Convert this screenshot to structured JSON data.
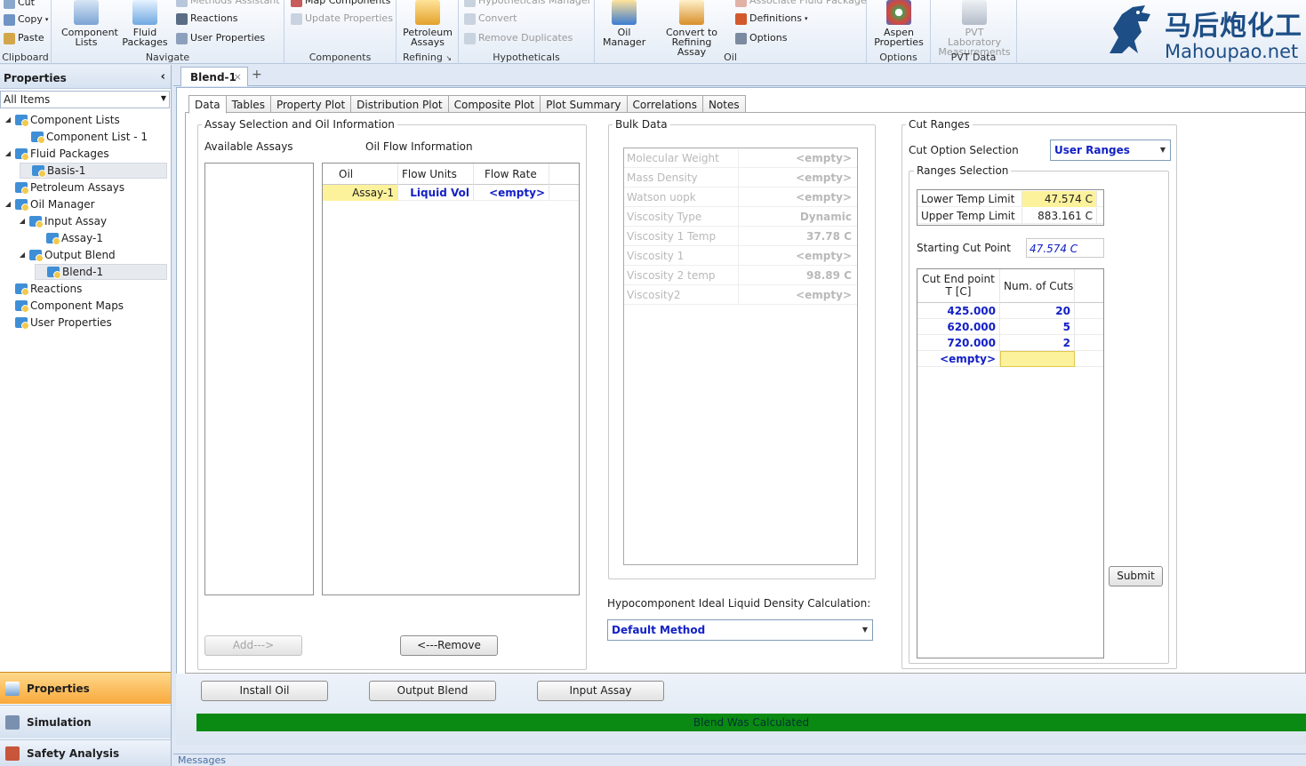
{
  "ribbon": {
    "clipboard": {
      "label": "Clipboard",
      "cut": "Cut",
      "copy": "Copy",
      "paste": "Paste"
    },
    "navigate": {
      "label": "Navigate",
      "component_lists": "Component Lists",
      "fluid_packages": "Fluid Packages",
      "methods_assistant": "Methods Assistant",
      "reactions": "Reactions",
      "user_properties": "User Properties"
    },
    "components": {
      "label": "Components",
      "map_components": "Map Components",
      "update_properties": "Update Properties"
    },
    "refining": {
      "label": "Refining",
      "petroleum_assays": "Petroleum Assays"
    },
    "hypotheticals": {
      "label": "Hypotheticals",
      "manager": "Hypotheticals Manager",
      "convert": "Convert",
      "remove_duplicates": "Remove Duplicates"
    },
    "oil": {
      "label": "Oil",
      "oil_manager": "Oil Manager",
      "convert_to_refining_assay": "Convert to Refining Assay",
      "associate_fluid_package": "Associate Fluid Package",
      "definitions": "Definitions",
      "options": "Options"
    },
    "options": {
      "label": "Options",
      "aspen_properties": "Aspen Properties"
    },
    "pvt": {
      "label": "PVT Data",
      "pvt_lab": "PVT Laboratory Measurements"
    }
  },
  "logo": {
    "cn": "马后炮化工",
    "en": "Mahoupao.net"
  },
  "left_panel": {
    "title": "Properties",
    "filter": "All Items",
    "tree": [
      {
        "label": "Component Lists"
      },
      {
        "label": "Component List - 1"
      },
      {
        "label": "Fluid Packages"
      },
      {
        "label": "Basis-1"
      },
      {
        "label": "Petroleum Assays"
      },
      {
        "label": "Oil Manager"
      },
      {
        "label": "Input Assay"
      },
      {
        "label": "Assay-1"
      },
      {
        "label": "Output Blend"
      },
      {
        "label": "Blend-1"
      },
      {
        "label": "Reactions"
      },
      {
        "label": "Component Maps"
      },
      {
        "label": "User Properties"
      }
    ],
    "nav": {
      "properties": "Properties",
      "simulation": "Simulation",
      "safety": "Safety Analysis"
    }
  },
  "doc_tab": {
    "title": "Blend-1",
    "close": "×",
    "add": "+"
  },
  "tabs": [
    "Data",
    "Tables",
    "Property Plot",
    "Distribution Plot",
    "Composite Plot",
    "Plot Summary",
    "Correlations",
    "Notes"
  ],
  "assay_section": {
    "legend": "Assay Selection and Oil Information",
    "available_label": "Available Assays",
    "oil_flow_label": "Oil Flow Information",
    "columns": [
      "Oil",
      "Flow Units",
      "Flow Rate"
    ],
    "row": {
      "oil": "Assay-1",
      "units": "Liquid Vol",
      "rate": "<empty>"
    },
    "add_button": "Add--->",
    "remove_button": "<---Remove"
  },
  "bulk": {
    "legend": "Bulk Data",
    "rows": [
      {
        "name": "Molecular Weight",
        "value": "<empty>"
      },
      {
        "name": "Mass Density",
        "value": "<empty>"
      },
      {
        "name": "Watson uopk",
        "value": "<empty>"
      },
      {
        "name": "Viscosity Type",
        "value": "Dynamic"
      },
      {
        "name": "Viscosity 1 Temp",
        "value": "37.78 C"
      },
      {
        "name": "Viscosity 1",
        "value": "<empty>"
      },
      {
        "name": "Viscosity 2 temp",
        "value": "98.89 C"
      },
      {
        "name": "Viscosity2",
        "value": "<empty>"
      }
    ],
    "hypo_label": "Hypocomponent Ideal Liquid Density Calculation:",
    "hypo_value": "Default Method"
  },
  "cut_ranges": {
    "legend": "Cut Ranges",
    "option_label": "Cut Option Selection",
    "option_value": "User Ranges",
    "ranges_legend": "Ranges Selection",
    "lower_label": "Lower Temp Limit",
    "lower_value": "47.574 C",
    "upper_label": "Upper Temp Limit",
    "upper_value": "883.161 C",
    "start_label": "Starting Cut Point",
    "start_value": "47.574 C",
    "columns": [
      "Cut End point T [C]",
      "Num. of Cuts"
    ],
    "rows": [
      {
        "end": "425.000",
        "num": "20"
      },
      {
        "end": "620.000",
        "num": "5"
      },
      {
        "end": "720.000",
        "num": "2"
      },
      {
        "end": "<empty>",
        "num": ""
      }
    ],
    "submit": "Submit"
  },
  "bottom": {
    "install_oil": "Install Oil",
    "output_blend": "Output Blend",
    "input_assay": "Input Assay",
    "status": "Blend Was Calculated"
  },
  "messages": "Messages",
  "colors": {
    "accent": "#f9a93c",
    "status": "#0a8a12",
    "value_blue": "#1320c5",
    "highlight": "#fdf29c"
  }
}
